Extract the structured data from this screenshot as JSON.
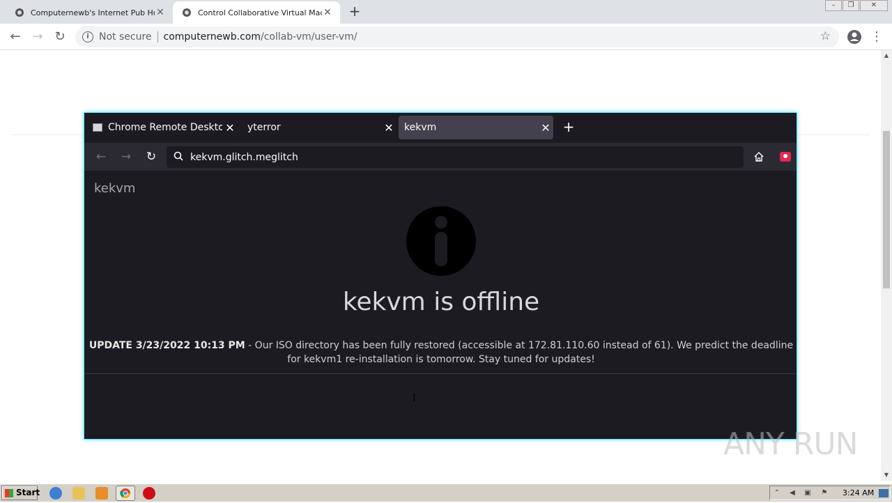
{
  "browser": {
    "tabs": [
      {
        "title": "Computernewb's Internet Pub Hub",
        "active": false
      },
      {
        "title": "Control Collaborative Virtual Machine",
        "active": true
      }
    ],
    "new_tab_symbol": "+",
    "omnibox": {
      "security": "Not secure",
      "host": "computernewb.com",
      "path": "/collab-vm/user-vm/"
    },
    "window_controls": [
      "minimize",
      "restore",
      "close"
    ]
  },
  "vm": {
    "tabs": [
      {
        "title": "Chrome Remote Desktop",
        "active": false
      },
      {
        "title": "yterror",
        "active": false
      },
      {
        "title": "kekvm",
        "active": true
      }
    ],
    "url": "kekvm.glitch.meglitch",
    "site_name": "kekvm",
    "offline_title": "kekvm is offline",
    "update_label": "UPDATE 3/23/2022 10:13 PM",
    "update_text": " - Our ISO directory has been fully restored (accessible at 172.81.110.60 instead of 61). We predict the deadline for kekvm1 re-installation is tomorrow. Stay tuned for updates!"
  },
  "watermark": "ANY RUN",
  "taskbar": {
    "start_label": "Start",
    "clock": "3:24 AM",
    "pinned": [
      "ie-icon",
      "explorer-icon",
      "media-player-icon",
      "chrome-icon",
      "opera-icon"
    ]
  },
  "colors": {
    "vm_border": "#67e1ff",
    "vm_bg": "#1c1b22",
    "vm_nav_bg": "#2b2a33",
    "active_tab_bg": "#42414d"
  }
}
